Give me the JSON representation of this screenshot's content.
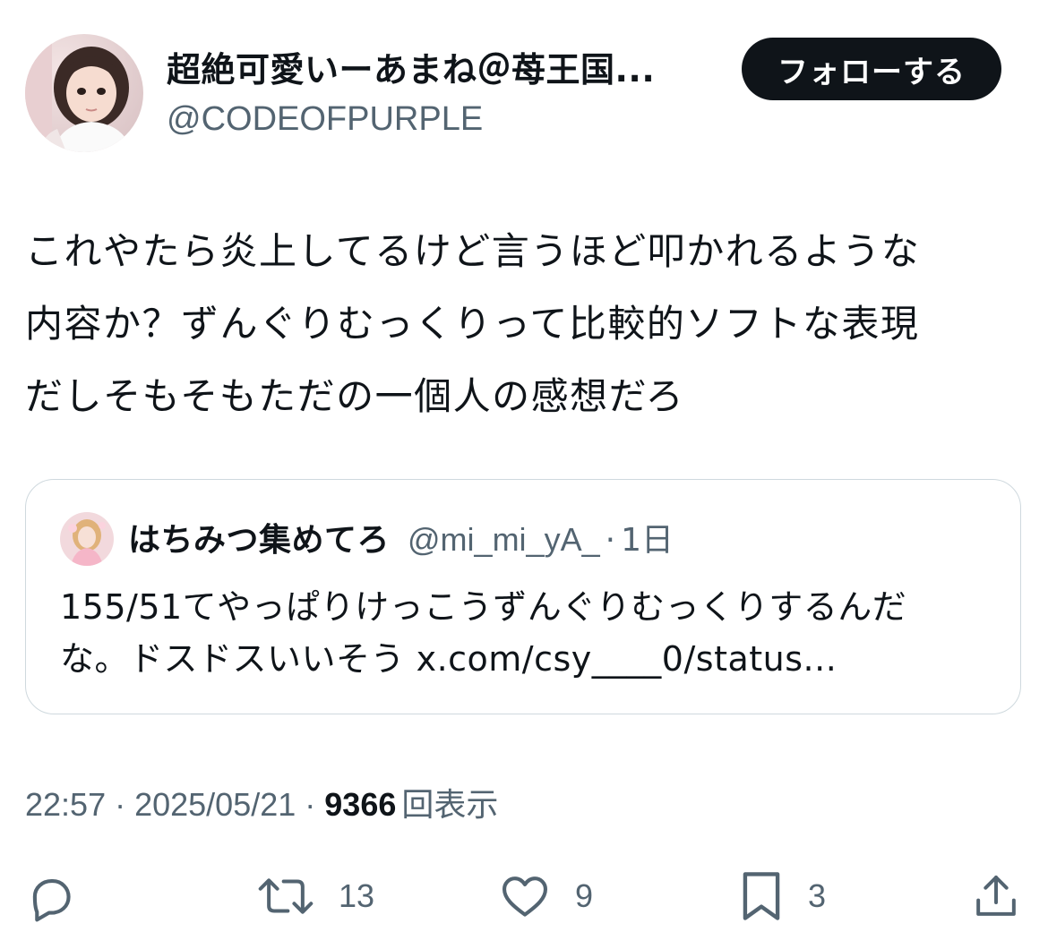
{
  "author": {
    "display_name": "超絶可愛いーあまね＠苺王国...",
    "handle": "@CODEOFPURPLE",
    "avatar_icon": "profile-photo"
  },
  "follow_button": {
    "label": "フォローする"
  },
  "tweet": {
    "lines": [
      "これやたら炎上してるけど言うほど叩かれるような",
      "内容か？ずんぐりむっくりって比較的ソフトな表現",
      "だしそもそもただの一個人の感想だろ"
    ]
  },
  "quote": {
    "display_name": "はちみつ集めてろ",
    "handle": "@mi_mi_yA_",
    "separator": "·",
    "time": "1日",
    "lines": [
      "155/51てやっぱりけっこうずんぐりむっくりするんだ",
      "な。ドスドスいいそう x.com/csy____0/status..."
    ]
  },
  "meta": {
    "time": "22:57",
    "separator": "·",
    "date": "2025/05/21",
    "views_count": "9366",
    "views_label": "回表示"
  },
  "actions": {
    "reply_icon": "reply-icon",
    "retweet_icon": "retweet-icon",
    "retweet_count": "13",
    "like_icon": "heart-icon",
    "like_count": "9",
    "bookmark_icon": "bookmark-icon",
    "bookmark_count": "3",
    "share_icon": "share-icon"
  },
  "colors": {
    "text_primary": "#0f1419",
    "text_secondary": "#536471",
    "border": "#cfd9de",
    "button_bg": "#0f1419",
    "button_text": "#ffffff"
  }
}
